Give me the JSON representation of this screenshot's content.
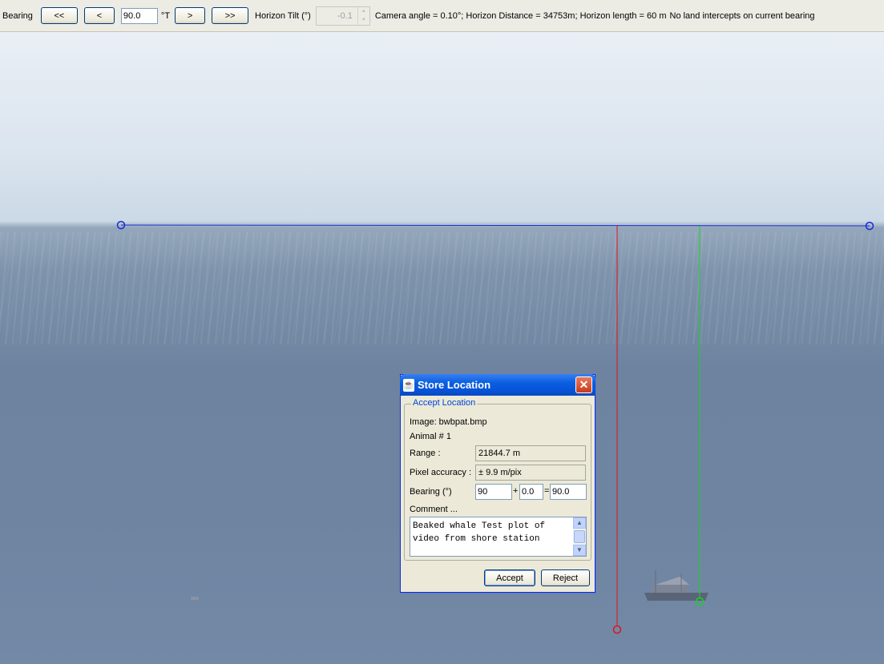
{
  "toolbar": {
    "bearing_label": "Bearing",
    "prev_large_label": "<<",
    "prev_small_label": "<",
    "bearing_value": "90.0",
    "bearing_unit": "°T",
    "next_small_label": ">",
    "next_large_label": ">>",
    "tilt_label": "Horizon Tilt (°)",
    "tilt_value": "-0.1",
    "status_text": "Camera angle = 0.10°; Horizon Distance = 34753m; Horizon length = 60 m",
    "intercept_text": "No land intercepts on current bearing"
  },
  "overlay_colors": {
    "horizon_line": "#1a2bd6",
    "range_marker": "#e0121f",
    "target_marker": "#15d61e"
  },
  "dialog": {
    "title": "Store Location",
    "close_symbol": "✕",
    "icon_symbol": "☕",
    "group_title": "Accept Location",
    "image_text": "Image: bwbpat.bmp",
    "animal_text": "Animal # 1",
    "range_label": "Range :",
    "range_value": "21844.7 m",
    "pixel_accuracy_label": "Pixel accuracy :",
    "pixel_accuracy_value": "± 9.9 m/pix",
    "bearing_label": "Bearing (°)",
    "bearing_base": "90",
    "plus_sign": "+",
    "bearing_offset": "0.0",
    "equals_sign": "=",
    "bearing_total": "90.0",
    "comment_label": "Comment ...",
    "comment_text": "Beaked whale Test plot of\nvideo from shore station",
    "accept_label": "Accept",
    "reject_label": "Reject"
  }
}
